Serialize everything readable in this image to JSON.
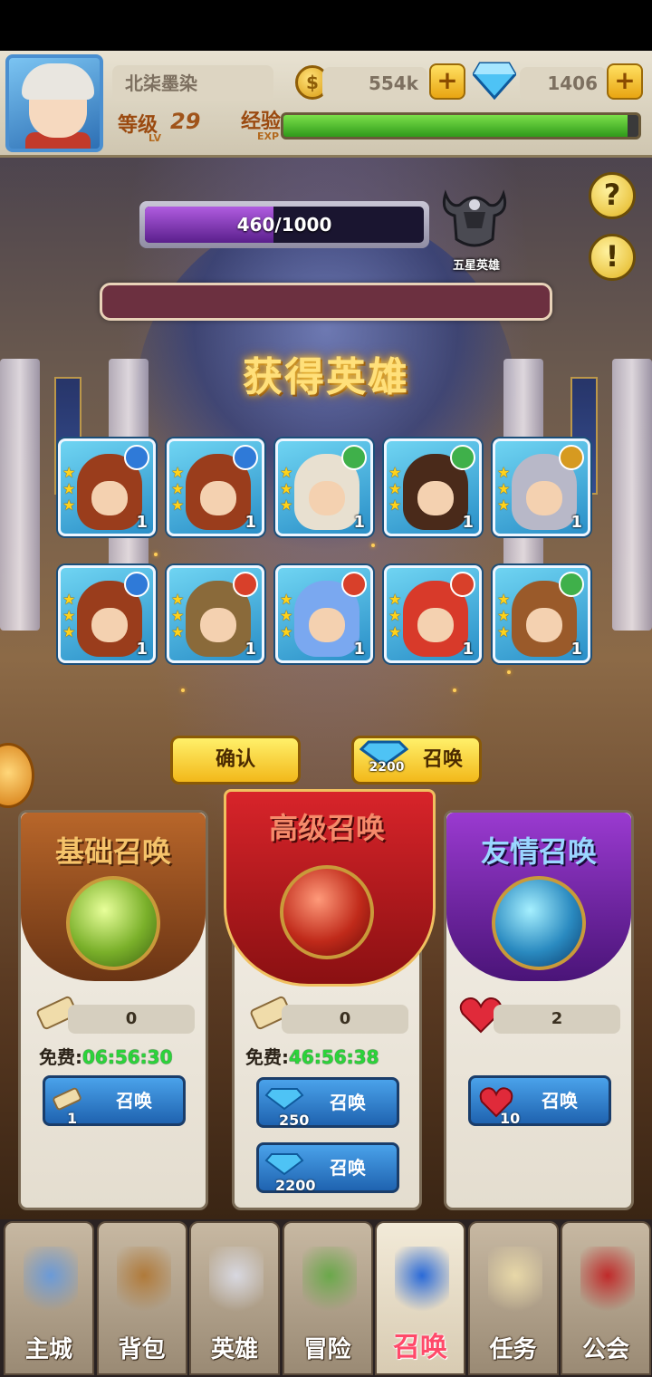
{
  "player": {
    "name": "北柒墨染",
    "level_label": "等级",
    "level_sub": "LV",
    "level": "29",
    "exp_label": "经验",
    "exp_sub": "EXP",
    "exp_fraction": 0.97,
    "gold": "554k",
    "gems": "1406",
    "gold_icon": "coin-icon",
    "gem_icon": "diamond-icon"
  },
  "star_progress": {
    "text": "460/1000",
    "current": 460,
    "max": 1000,
    "reward_label": "五星英雄"
  },
  "side_buttons": {
    "help": "?",
    "notice": "!"
  },
  "result": {
    "title": "获得英雄",
    "heroes": [
      {
        "element": "water",
        "stars": 3,
        "count": "1",
        "hair": "#9a3d1c"
      },
      {
        "element": "water",
        "stars": 3,
        "count": "1",
        "hair": "#9a3d1c"
      },
      {
        "element": "wind",
        "stars": 3,
        "count": "1",
        "hair": "#e8e0d0"
      },
      {
        "element": "wind",
        "stars": 3,
        "count": "1",
        "hair": "#4a2a1a"
      },
      {
        "element": "earth",
        "stars": 3,
        "count": "1",
        "hair": "#b8b8c8"
      },
      {
        "element": "water",
        "stars": 3,
        "count": "1",
        "hair": "#9a3d1c"
      },
      {
        "element": "fire",
        "stars": 3,
        "count": "1",
        "hair": "#8a6a3a"
      },
      {
        "element": "fire",
        "stars": 3,
        "count": "1",
        "hair": "#7aa8f0"
      },
      {
        "element": "fire",
        "stars": 3,
        "count": "1",
        "hair": "#d83a2a"
      },
      {
        "element": "wind",
        "stars": 3,
        "count": "1",
        "hair": "#9a5a2a"
      }
    ],
    "confirm_label": "确认",
    "resummon_cost": "2200",
    "resummon_label": "召唤"
  },
  "colors": {
    "water": "#2f7ad8",
    "wind": "#3fb04a",
    "earth": "#d69a20",
    "fire": "#d8402a"
  },
  "panels": {
    "basic": {
      "title": "基础召唤",
      "count": "0",
      "free_label": "免费:",
      "free_time": "06:56:30",
      "btn_cost": "1",
      "btn_label": "召唤"
    },
    "advanced": {
      "title": "高级召唤",
      "count": "0",
      "free_label": "免费:",
      "free_time": "46:56:38",
      "btn1_cost": "250",
      "btn1_label": "召唤",
      "btn2_cost": "2200",
      "btn2_label": "召唤"
    },
    "friend": {
      "title": "友情召唤",
      "count": "2",
      "btn_cost": "10",
      "btn_label": "召唤"
    }
  },
  "nav": [
    {
      "label": "主城",
      "icon": "castle-icon"
    },
    {
      "label": "背包",
      "icon": "backpack-icon"
    },
    {
      "label": "英雄",
      "icon": "helmet-icon"
    },
    {
      "label": "冒险",
      "icon": "island-icon"
    },
    {
      "label": "召唤",
      "icon": "staff-icon",
      "active": true
    },
    {
      "label": "任务",
      "icon": "scroll-icon"
    },
    {
      "label": "公会",
      "icon": "guild-banner-icon"
    }
  ]
}
